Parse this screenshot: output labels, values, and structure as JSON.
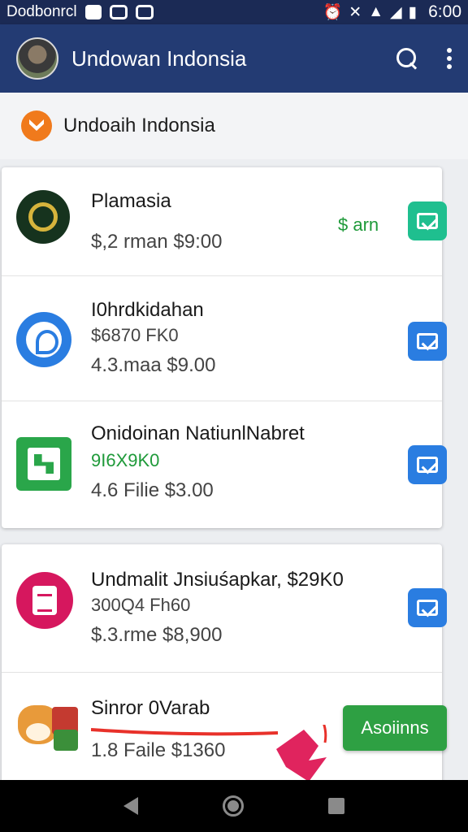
{
  "status_bar": {
    "carrier": "Dodbonrcl",
    "time": "6:00"
  },
  "app_bar": {
    "title": "Undowan Indonsia"
  },
  "subheader": {
    "title": "Undoaih Indonsia"
  },
  "list_group_1": [
    {
      "title": "Plamasia",
      "meta": "$,2 rman $9:00",
      "side_text": "$ arn",
      "action_color": "#1fbf8f"
    },
    {
      "title": "I0hrdkidahan",
      "sub": "$6870 FK0",
      "meta": "4.3.maa $9.00",
      "action_color": "#2a7de1"
    },
    {
      "title": "Onidoinan NatiunlNabret",
      "sub": "9I6X9K0",
      "meta": "4.6 Filie $3.00",
      "action_color": "#2a7de1"
    }
  ],
  "list_group_2": [
    {
      "title": "Undmalit Jnsiuśapkar, $29K0",
      "sub": "300Q4 Fh60",
      "meta": "$.3.rme $8,900",
      "action_color": "#2a7de1"
    },
    {
      "title": "Sinror 0Varab",
      "meta": "1.8 Faile $1360",
      "button_label": "Asoiinns"
    }
  ],
  "colors": {
    "status_bar": "#1b2a55",
    "app_bar": "#233b73",
    "accent_green": "#2ea043",
    "accent_blue": "#2a7de1"
  }
}
